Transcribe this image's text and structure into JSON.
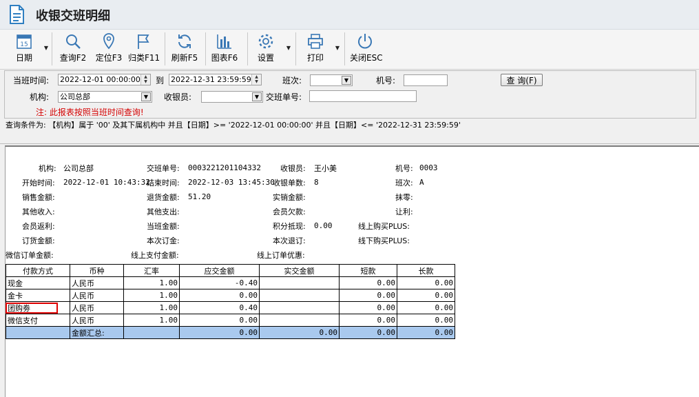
{
  "window": {
    "title": "收银交班明细"
  },
  "toolbar": {
    "date": {
      "label": "日期",
      "icon": "calendar-icon",
      "day": "15"
    },
    "query": {
      "label": "查询F2",
      "icon": "search-icon"
    },
    "locate": {
      "label": "定位F3",
      "icon": "location-pin-icon"
    },
    "classify": {
      "label": "归类F11",
      "icon": "flag-icon"
    },
    "refresh": {
      "label": "刷新F5",
      "icon": "refresh-icon"
    },
    "chart": {
      "label": "图表F6",
      "icon": "bar-chart-icon"
    },
    "settings": {
      "label": "设置",
      "icon": "gear-icon"
    },
    "print": {
      "label": "打印",
      "icon": "printer-icon"
    },
    "close": {
      "label": "关闭ESC",
      "icon": "power-icon"
    }
  },
  "filter": {
    "shift_time_label": "当班时间:",
    "start": "2022-12-01 00:00:00",
    "to_label": "到",
    "end": "2022-12-31 23:59:59",
    "shift_label": "班次:",
    "shift_value": "",
    "machine_label": "机号:",
    "machine_value": "",
    "query_button": "查 询(F)",
    "org_label": "机构:",
    "org_value": "公司总部",
    "cashier_label": "收银员:",
    "cashier_value": "",
    "handover_label": "交班单号:",
    "handover_value": "",
    "warning": "注: 此报表按照当班时间查询!"
  },
  "condition": "查询条件为: 【机构】属于 '00' 及其下属机构中 并且【日期】>= '2022-12-01 00:00:00' 并且【日期】<= '2022-12-31 23:59:59'",
  "report": {
    "org_label": "机构:",
    "org_value": "公司总部",
    "handover_no_label": "交班单号:",
    "handover_no_value": "0003221201104332",
    "cashier_label": "收银员:",
    "cashier_value": "王小美",
    "machine_label": "机号:",
    "machine_value": "0003",
    "start_label": "开始时间:",
    "start_value": "2022-12-01 10:43:32",
    "end_label": "结束时间:",
    "end_value": "2022-12-03 13:45:30",
    "cashier_count_label": "收银单数:",
    "cashier_count_value": "8",
    "shift_label": "班次:",
    "shift_value": "A",
    "sales_label": "销售金额:",
    "return_label": "退货金额:",
    "return_value": "51.20",
    "actual_sales_label": "实销金额:",
    "rounding_label": "抹零:",
    "other_income_label": "其他收入:",
    "other_expense_label": "其他支出:",
    "member_debt_label": "会员欠款:",
    "discount_label": "让利:",
    "member_rebate_label": "会员返利:",
    "shift_amount_label": "当班金额:",
    "points_label": "积分抵现:",
    "points_value": "0.00",
    "online_plus_label": "线上购买PLUS:",
    "deposit_label": "订货金额:",
    "this_deposit_label": "本次订金:",
    "this_refund_label": "本次退订:",
    "offline_plus_label": "线下购买PLUS:",
    "wechat_order_label": "微信订单金额:",
    "online_pay_label": "线上支付金额:",
    "online_discount_label": "线上订单优惠:"
  },
  "table": {
    "headers": [
      "付款方式",
      "币种",
      "汇率",
      "应交金额",
      "实交金额",
      "短款",
      "长款"
    ],
    "rows": [
      [
        "现金",
        "人民币",
        "1.00",
        "-0.40",
        "",
        "0.00",
        "0.00"
      ],
      [
        "金卡",
        "人民币",
        "1.00",
        "0.00",
        "",
        "0.00",
        "0.00"
      ],
      [
        "团购劵",
        "人民币",
        "1.00",
        "0.40",
        "",
        "0.00",
        "0.00"
      ],
      [
        "微信支付",
        "人民币",
        "1.00",
        "0.00",
        "",
        "0.00",
        "0.00"
      ]
    ],
    "summary": [
      "",
      "金额汇总:",
      "",
      "0.00",
      "0.00",
      "0.00",
      "0.00"
    ]
  },
  "colors": {
    "summary_row": "#a9c9ee",
    "highlight": "#e00000",
    "warning": "#d40000"
  }
}
